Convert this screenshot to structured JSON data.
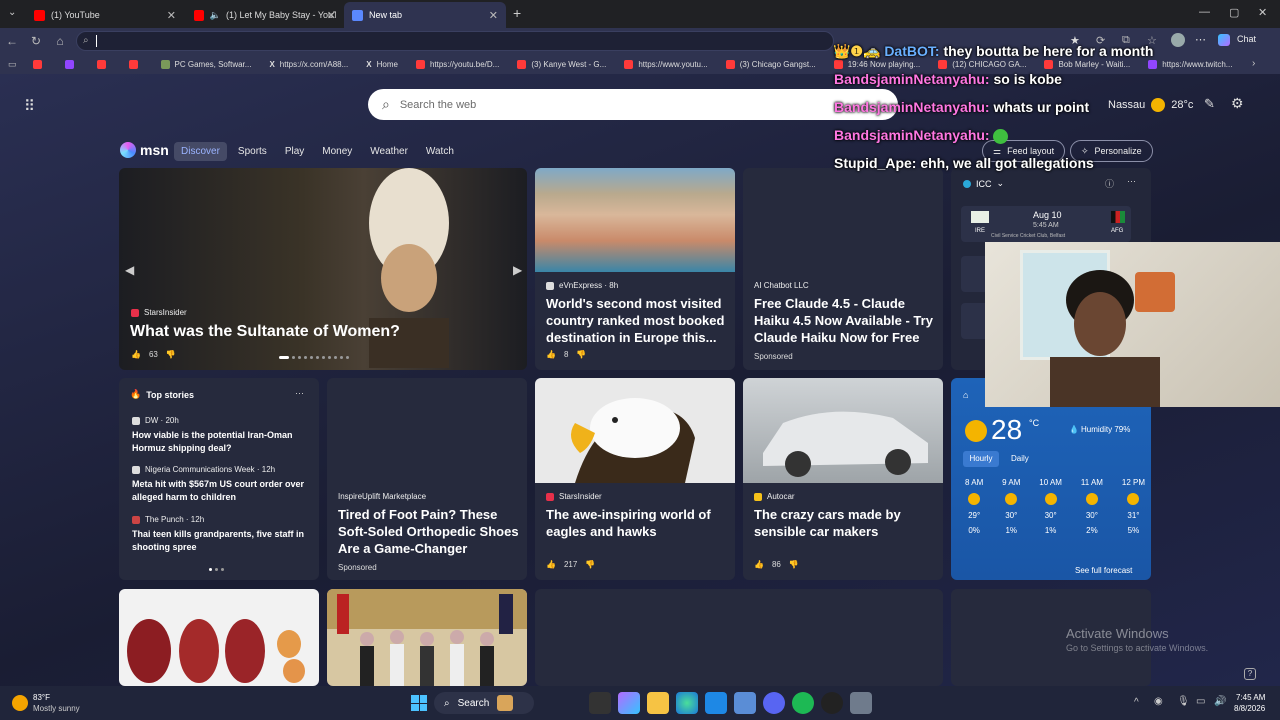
{
  "tabs": [
    {
      "label": "(1) YouTube",
      "color": "#ff0000"
    },
    {
      "label": "(1) Let My Baby Stay - YouTube",
      "color": "#ff0000"
    },
    {
      "label": "New tab",
      "color": "#5a88ff"
    }
  ],
  "toolbar": {
    "address_value": "",
    "chat_label": "Chat"
  },
  "bookmarks": [
    {
      "label": "",
      "color": "#ff3a3a"
    },
    {
      "label": "",
      "color": "#9146ff"
    },
    {
      "label": "",
      "color": "#ff3a3a"
    },
    {
      "label": "",
      "color": "#ff3a3a"
    },
    {
      "label": "PC Games, Softwar...",
      "color": "#7a9a5a"
    },
    {
      "label": "https://x.com/A88...",
      "color": "#000000"
    },
    {
      "label": "Home",
      "color": "#000000"
    },
    {
      "label": "https://youtu.be/D...",
      "color": "#ff3a3a"
    },
    {
      "label": "(3) Kanye West - G...",
      "color": "#ff3a3a"
    },
    {
      "label": "https://www.youtu...",
      "color": "#ff3a3a"
    },
    {
      "label": "(3) Chicago Gangst...",
      "color": "#ff3a3a"
    },
    {
      "label": "19:46 Now playing...",
      "color": "#ff3a3a"
    },
    {
      "label": "(12) CHICAGO GA...",
      "color": "#ff3a3a"
    },
    {
      "label": "Bob Marley - Waiti...",
      "color": "#ff3a3a"
    },
    {
      "label": "https://www.twitch...",
      "color": "#9146ff"
    }
  ],
  "search": {
    "placeholder": "Search the web"
  },
  "weather_top": {
    "city": "Nassau",
    "temp": "28°c"
  },
  "msn": {
    "logo": "msn",
    "nav": [
      "Discover",
      "Sports",
      "Play",
      "Money",
      "Weather",
      "Watch"
    ],
    "feed_layout": "Feed layout",
    "personalize": "Personalize"
  },
  "hero": {
    "source": "StarsInsider",
    "title": "What was the Sultanate of Women?",
    "likes": "63"
  },
  "card_beach": {
    "source": "eVnExpress · 8h",
    "title": "World's second most visited country ranked most booked destination in Europe this...",
    "likes": "8"
  },
  "card_claude": {
    "source": "AI Chatbot LLC",
    "title": "Free Claude 4.5 - Claude Haiku 4.5 Now Available - Try Claude Haiku Now for Free",
    "sponsored": "Sponsored"
  },
  "cricket": {
    "league": "ICC",
    "date": "Aug 10",
    "time": "5:45 AM",
    "venue": "Civil Service Cricket Club, Belfast",
    "team_left": "IRE",
    "team_right": "AFG"
  },
  "top_stories": {
    "header": "Top stories",
    "items": [
      {
        "source": "DW · 20h",
        "title": "How viable is the potential Iran-Oman Hormuz shipping deal?"
      },
      {
        "source": "Nigeria Communications Week · 12h",
        "title": "Meta hit with $567m US court order over alleged harm to children"
      },
      {
        "source": "The Punch · 12h",
        "title": "Thai teen kills grandparents, five staff in shooting spree"
      }
    ]
  },
  "card_shoes": {
    "source": "InspireUplift Marketplace",
    "title": "Tired of Foot Pain? These Soft-Soled Orthopedic Shoes Are a Game-Changer",
    "sponsored": "Sponsored"
  },
  "card_eagle": {
    "source": "StarsInsider",
    "title": "The awe-inspiring world of eagles and hawks",
    "likes": "217"
  },
  "card_cars": {
    "source": "Autocar",
    "title": "The crazy cars made by sensible car makers",
    "likes": "86"
  },
  "weather_widget": {
    "temp": "28",
    "unit": "°C",
    "humidity": "Humidity 79%",
    "tab_hourly": "Hourly",
    "tab_daily": "Daily",
    "hours": [
      {
        "time": "8 AM",
        "temp": "29°",
        "rain": "0%"
      },
      {
        "time": "9 AM",
        "temp": "30°",
        "rain": "1%"
      },
      {
        "time": "10 AM",
        "temp": "30°",
        "rain": "1%"
      },
      {
        "time": "11 AM",
        "temp": "30°",
        "rain": "2%"
      },
      {
        "time": "12 PM",
        "temp": "31°",
        "rain": "5%"
      }
    ],
    "see_full": "See full forecast"
  },
  "chat_overlay": [
    {
      "user": "DatBOT:",
      "message": "they boutta be here for a month"
    },
    {
      "user": "BandsjaminNetanyahu:",
      "message": "so is kobe"
    },
    {
      "user": "BandsjaminNetanyahu:",
      "message": "whats ur point"
    },
    {
      "user": "BandsjaminNetanyahu:",
      "message": ""
    },
    {
      "user": "Stupid_Ape:",
      "message": "ehh, we all got allegations"
    }
  ],
  "watermark": {
    "line1": "Activate Windows",
    "line2": "Go to Settings to activate Windows."
  },
  "taskbar": {
    "weather_temp": "83°F",
    "weather_desc": "Mostly sunny",
    "search_label": "Search",
    "time": "7:45 AM",
    "date": "8/8/2026"
  }
}
